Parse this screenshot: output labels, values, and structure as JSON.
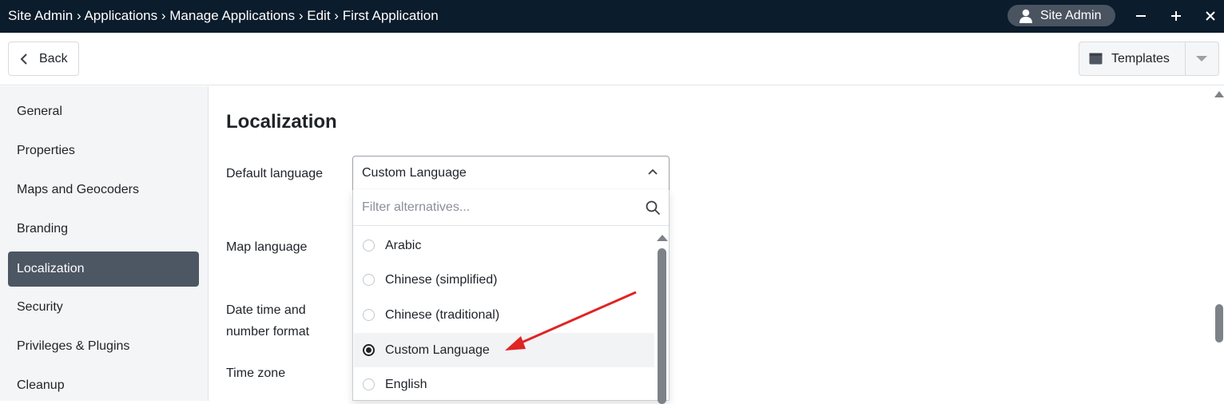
{
  "titlebar": {
    "breadcrumb": [
      "Site Admin",
      "Applications",
      "Manage Applications",
      "Edit",
      "First Application"
    ],
    "separator": "›",
    "user_label": "Site Admin",
    "minimize_glyph": "−",
    "add_glyph": "+",
    "close_glyph": "✕"
  },
  "toolbar": {
    "back_label": "Back",
    "templates_label": "Templates"
  },
  "sidebar": {
    "items": [
      {
        "label": "General",
        "active": false
      },
      {
        "label": "Properties",
        "active": false
      },
      {
        "label": "Maps and Geocoders",
        "active": false
      },
      {
        "label": "Branding",
        "active": false
      },
      {
        "label": "Localization",
        "active": true
      },
      {
        "label": "Security",
        "active": false
      },
      {
        "label": "Privileges & Plugins",
        "active": false
      },
      {
        "label": "Cleanup",
        "active": false
      }
    ]
  },
  "main": {
    "title": "Localization",
    "labels": {
      "default_language": "Default language",
      "map_language": "Map language",
      "date_time_line1": "Date time and",
      "date_time_line2": "number format",
      "time_zone": "Time zone"
    },
    "default_language": {
      "value": "Custom Language",
      "filter_placeholder": "Filter alternatives...",
      "options": [
        {
          "label": "Arabic",
          "selected": false
        },
        {
          "label": "Chinese (simplified)",
          "selected": false
        },
        {
          "label": "Chinese (traditional)",
          "selected": false
        },
        {
          "label": "Custom Language",
          "selected": true
        },
        {
          "label": "English",
          "selected": false
        }
      ]
    }
  },
  "colors": {
    "titlebar_bg": "#0b1c2c",
    "active_nav_bg": "#4d5663",
    "annotation_arrow": "#e02424"
  },
  "icons": {
    "user": "user-icon",
    "minimize": "minimize-icon",
    "add": "plus-icon",
    "close": "close-icon",
    "back": "chevron-left-icon",
    "templates": "template-icon",
    "templates_menu": "caret-down-icon",
    "select_open": "chevron-up-icon",
    "search": "search-icon"
  }
}
